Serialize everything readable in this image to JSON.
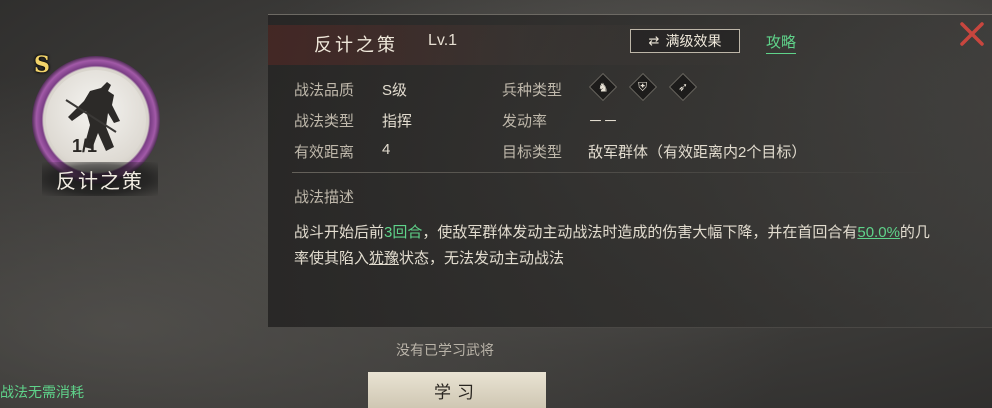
{
  "skill": {
    "name": "反计之策",
    "level": "Lv.1",
    "max_effect_label": "满级效果",
    "guide_label": "攻略"
  },
  "portrait": {
    "grade": "S",
    "count": "1/1",
    "name": "反计之策",
    "ring_color": "#a25aa8"
  },
  "attributes": {
    "quality_label": "战法品质",
    "quality_value": "S级",
    "type_label": "战法类型",
    "type_value": "指挥",
    "range_label": "有效距离",
    "range_value": "4",
    "troop_label": "兵种类型",
    "troop_icons": [
      "cavalry-icon",
      "shield-icon",
      "bow-icon"
    ],
    "rate_label": "发动率",
    "rate_value": "－－",
    "target_label": "目标类型",
    "target_value": "敌军群体（有效距离内2个目标）"
  },
  "description": {
    "title": "战法描述",
    "part1": "战斗开始后前",
    "rounds": "3回合",
    "part2": "，使敌军群体发动主动战法时造成的伤害大幅下降，并在首回合有",
    "chance": "50.0%",
    "part3": "的几率使其陷入",
    "status": "犹豫",
    "part4": "状态，无法发动主动战法"
  },
  "footer": {
    "no_learned": "没有已学习武将",
    "learn_button": "学习",
    "no_cost": "战法无需消耗"
  },
  "colors": {
    "accent_green": "#5fd38a",
    "close_red": "#c8463e",
    "grade_gold": "#f2d36a"
  }
}
